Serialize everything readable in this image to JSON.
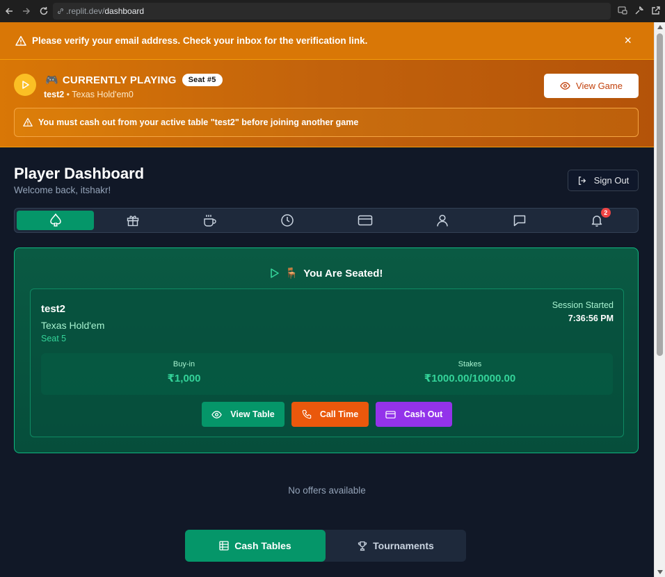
{
  "browser": {
    "url_host": ".replit.dev/",
    "url_path": "dashboard"
  },
  "verify_banner": {
    "message": "Please verify your email address. Check your inbox for the verification link.",
    "close_label": "×"
  },
  "currently_playing": {
    "emoji": "🎮",
    "title": "CURRENTLY PLAYING",
    "seat_badge": "Seat #5",
    "table_name": "test2",
    "separator": " • ",
    "game": "Texas Hold'em0",
    "view_game_label": "View Game",
    "warning": "You must cash out from your active table \"test2\" before joining another game"
  },
  "dashboard": {
    "title": "Player Dashboard",
    "welcome": "Welcome back, itshakr!",
    "sign_out_label": "Sign Out"
  },
  "tabs": {
    "active_index": 0,
    "items": [
      {
        "icon": "spade-icon"
      },
      {
        "icon": "gift-icon"
      },
      {
        "icon": "coffee-icon"
      },
      {
        "icon": "clock-icon"
      },
      {
        "icon": "card-icon"
      },
      {
        "icon": "user-icon"
      },
      {
        "icon": "chat-icon"
      },
      {
        "icon": "bell-icon",
        "badge": "2"
      }
    ]
  },
  "seated": {
    "title": "You Are Seated!",
    "chair_emoji": "🪑",
    "table_name": "test2",
    "game": "Texas Hold'em",
    "seat": "Seat 5",
    "session_label": "Session Started",
    "session_time": "7:36:56 PM",
    "buyin_label": "Buy-in",
    "buyin_value": "₹1,000",
    "stakes_label": "Stakes",
    "stakes_value": "₹1000.00/10000.00",
    "view_table_label": "View Table",
    "call_time_label": "Call Time",
    "cash_out_label": "Cash Out"
  },
  "offers": {
    "empty_text": "No offers available"
  },
  "bottom_tabs": {
    "cash_tables_label": "Cash Tables",
    "tournaments_label": "Tournaments"
  },
  "colors": {
    "accent_green": "#059669",
    "banner_orange": "#d97706",
    "call_orange": "#ea580c",
    "cash_purple": "#9333ea"
  }
}
